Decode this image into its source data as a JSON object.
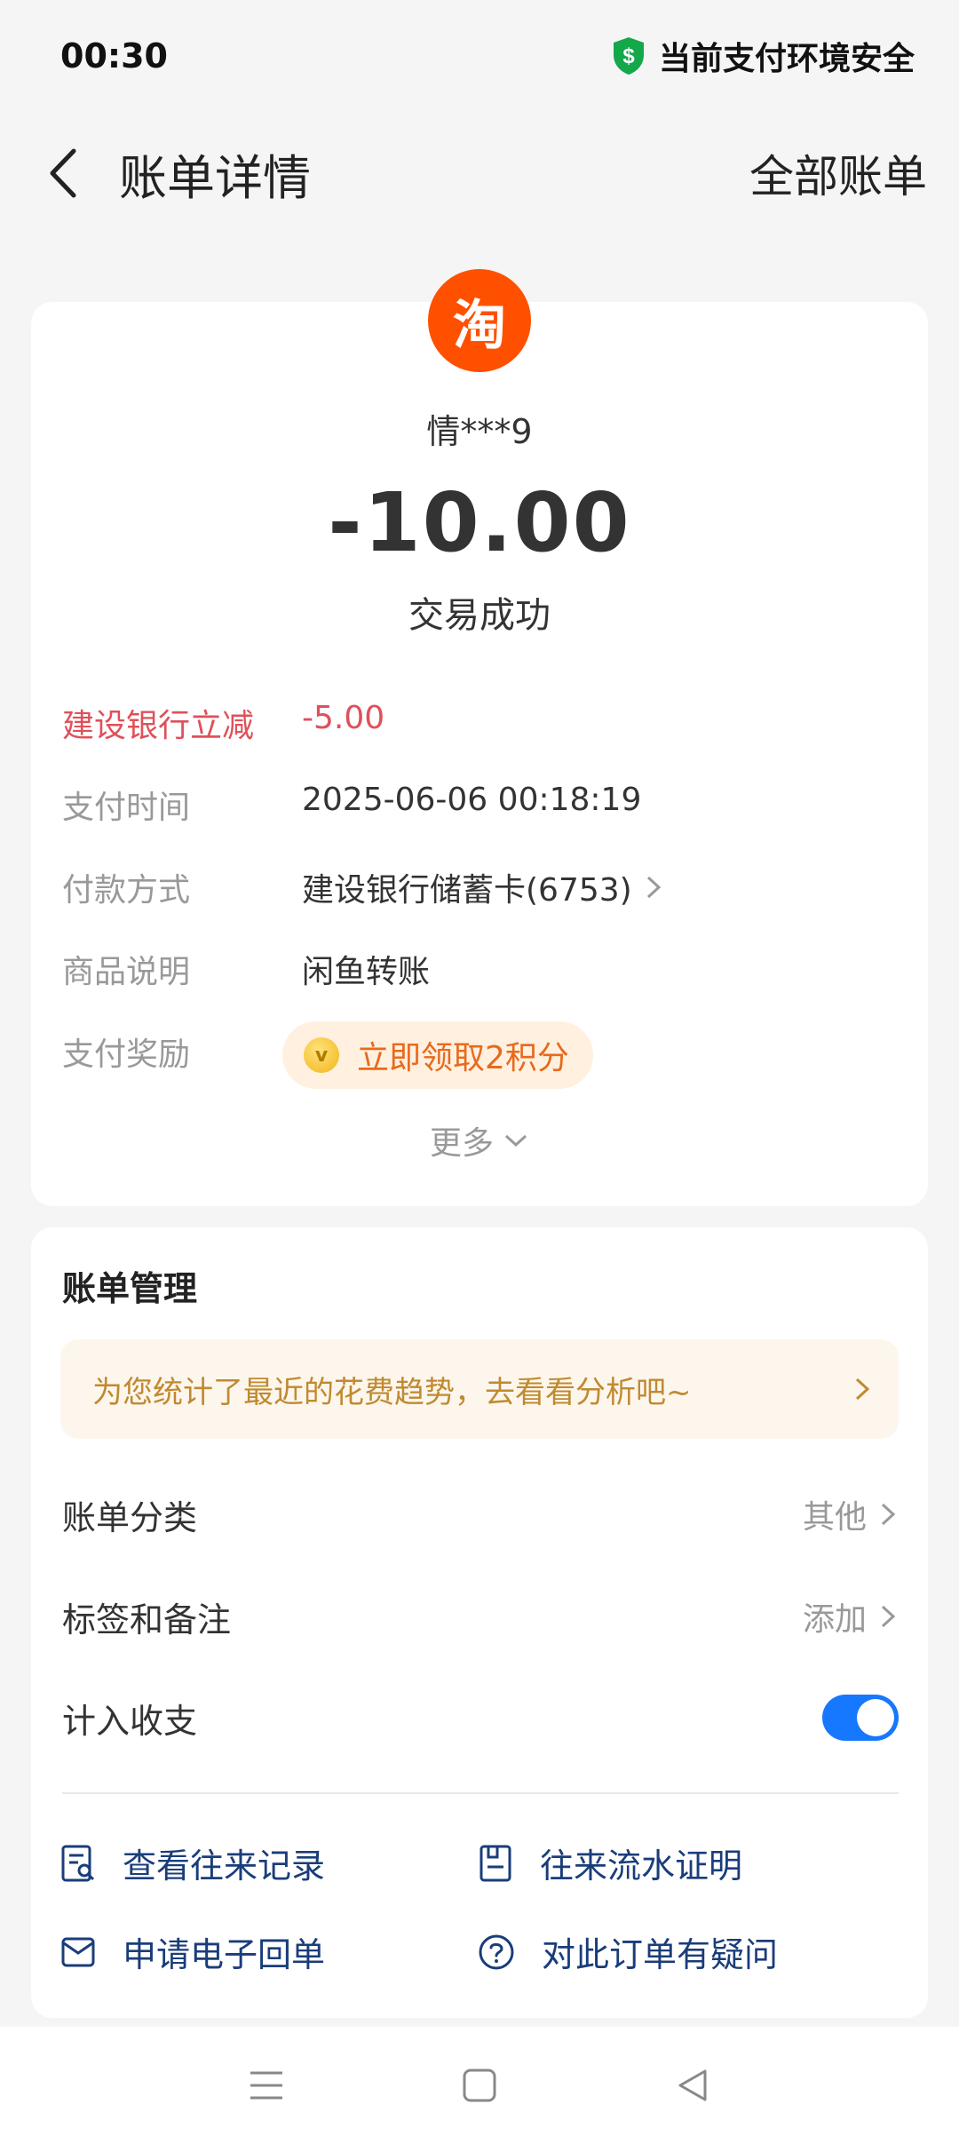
{
  "status_bar": {
    "time": "00:30",
    "security_text": "当前支付环境安全"
  },
  "header": {
    "title": "账单详情",
    "right_link": "全部账单"
  },
  "merchant": {
    "logo_char": "淘",
    "name": "情***9"
  },
  "transaction": {
    "amount": "-10.00",
    "status": "交易成功"
  },
  "details": {
    "discount_label": "建设银行立减",
    "discount_value": "-5.00",
    "pay_time_label": "支付时间",
    "pay_time_value": "2025-06-06 00:18:19",
    "pay_method_label": "付款方式",
    "pay_method_value": "建设银行储蓄卡(6753)",
    "product_label": "商品说明",
    "product_value": "闲鱼转账",
    "reward_label": "支付奖励",
    "reward_button": "立即领取2积分",
    "more_label": "更多"
  },
  "management": {
    "title": "账单管理",
    "tip": "为您统计了最近的花费趋势，去看看分析吧~",
    "category_label": "账单分类",
    "category_value": "其他",
    "tags_label": "标签和备注",
    "tags_value": "添加",
    "count_label": "计入收支",
    "count_enabled": true
  },
  "actions": {
    "history": "查看往来记录",
    "proof": "往来流水证明",
    "receipt": "申请电子回单",
    "question": "对此订单有疑问"
  },
  "colors": {
    "accent_blue": "#1677ff",
    "discount_red": "#e0505a",
    "taobao_orange": "#ff5000",
    "action_navy": "#1a3d7a"
  }
}
